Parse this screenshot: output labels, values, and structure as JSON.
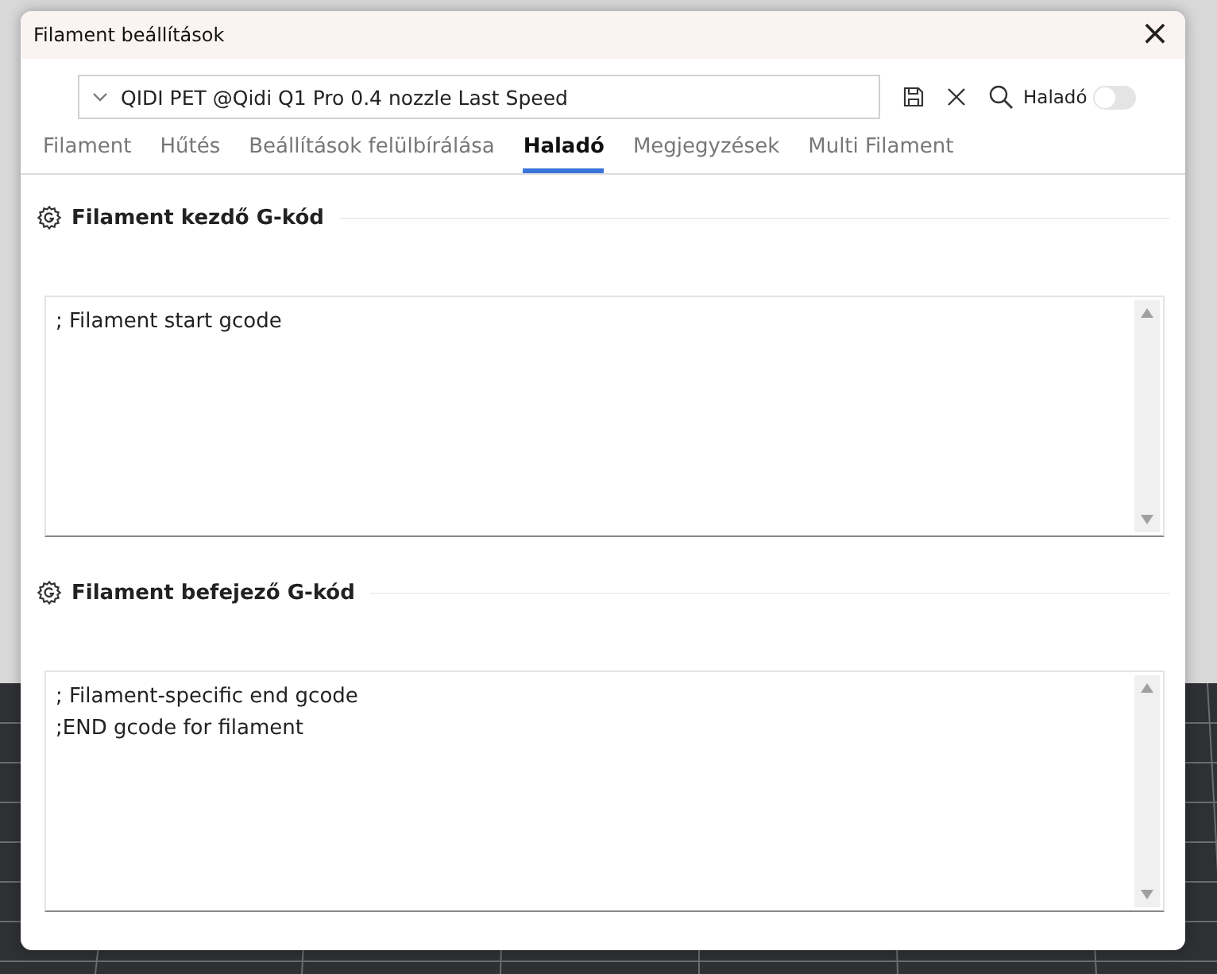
{
  "window": {
    "title": "Filament beállítások",
    "close": "×"
  },
  "toolbar": {
    "preset": "QIDI PET @Qidi Q1 Pro 0.4 nozzle Last Speed",
    "advanced_label": "Haladó",
    "advanced_on": false
  },
  "tabs": [
    {
      "label": "Filament",
      "selected": false
    },
    {
      "label": "Hűtés",
      "selected": false
    },
    {
      "label": "Beállítások felülbírálása",
      "selected": false
    },
    {
      "label": "Haladó",
      "selected": true
    },
    {
      "label": "Megjegyzések",
      "selected": false
    },
    {
      "label": "Multi Filament",
      "selected": false
    }
  ],
  "sections": [
    {
      "title": "Filament kezdő G-kód",
      "lines": [
        "; Filament start gcode"
      ]
    },
    {
      "title": "Filament befejező G-kód",
      "lines": [
        "; Filament-specific end gcode",
        ";END gcode for filament"
      ]
    }
  ]
}
